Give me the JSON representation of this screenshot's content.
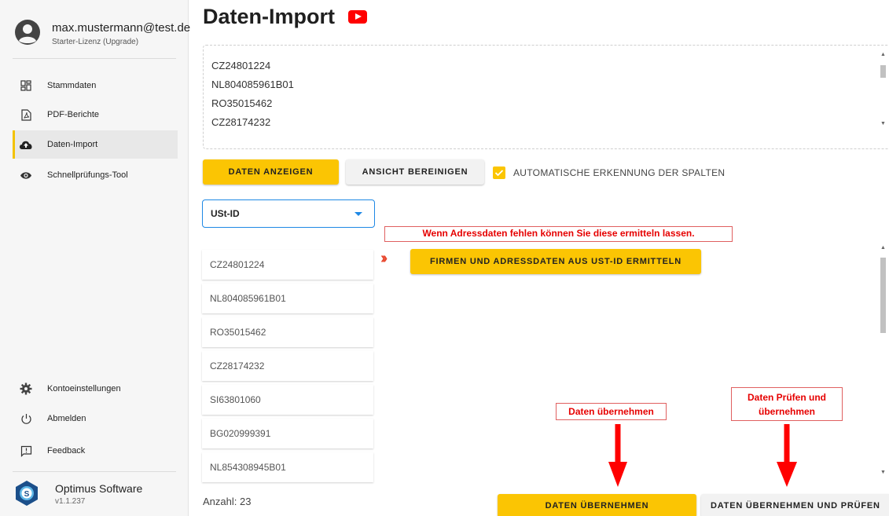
{
  "user": {
    "email": "max.mustermann@test.de",
    "license": "Starter-Lizenz (Upgrade)"
  },
  "nav": {
    "items": [
      {
        "label": "Stammdaten",
        "icon": "dashboard-icon"
      },
      {
        "label": "PDF-Berichte",
        "icon": "pdf-icon"
      },
      {
        "label": "Daten-Import",
        "icon": "cloud-upload-icon",
        "active": true
      },
      {
        "label": "Schnellprüfungs-Tool",
        "icon": "eye-icon"
      }
    ],
    "bottom": [
      {
        "label": "Kontoeinstellungen",
        "icon": "gear-icon"
      },
      {
        "label": "Abmelden",
        "icon": "power-icon"
      },
      {
        "label": "Feedback",
        "icon": "feedback-icon"
      }
    ]
  },
  "brand": {
    "name": "Optimus Software",
    "version": "v1.1.237"
  },
  "page": {
    "title": "Daten-Import"
  },
  "import_text": [
    "CZ24801224",
    "NL804085961B01",
    "RO35015462",
    "CZ28174232"
  ],
  "toolbar": {
    "show_label": "DATEN ANZEIGEN",
    "clear_label": "ANSICHT BEREINIGEN",
    "auto_detect_label": "AUTOMATISCHE ERKENNUNG DER SPALTEN",
    "auto_detect_checked": true
  },
  "column_select": {
    "value": "USt-ID"
  },
  "hints": {
    "address": "Wenn Adressdaten fehlen können Sie diese ermitteln lassen.",
    "take_over": "Daten übernehmen",
    "check_take_over": "Daten Prüfen und übernehmen"
  },
  "address_button_label": "FIRMEN UND ADRESSDATEN AUS UST-ID ERMITTELN",
  "vat_list": [
    "CZ24801224",
    "NL804085961B01",
    "RO35015462",
    "CZ28174232",
    "SI63801060",
    "BG020999391",
    "NL854308945B01"
  ],
  "count_label": "Anzahl: 23",
  "actions": {
    "take_over_label": "DATEN ÜBERNEHMEN",
    "check_take_over_label": "DATEN ÜBERNEHMEN UND PRÜFEN"
  },
  "colors": {
    "accent": "#fbc503",
    "annotation": "#e60000",
    "select_border": "#1e88e5"
  }
}
